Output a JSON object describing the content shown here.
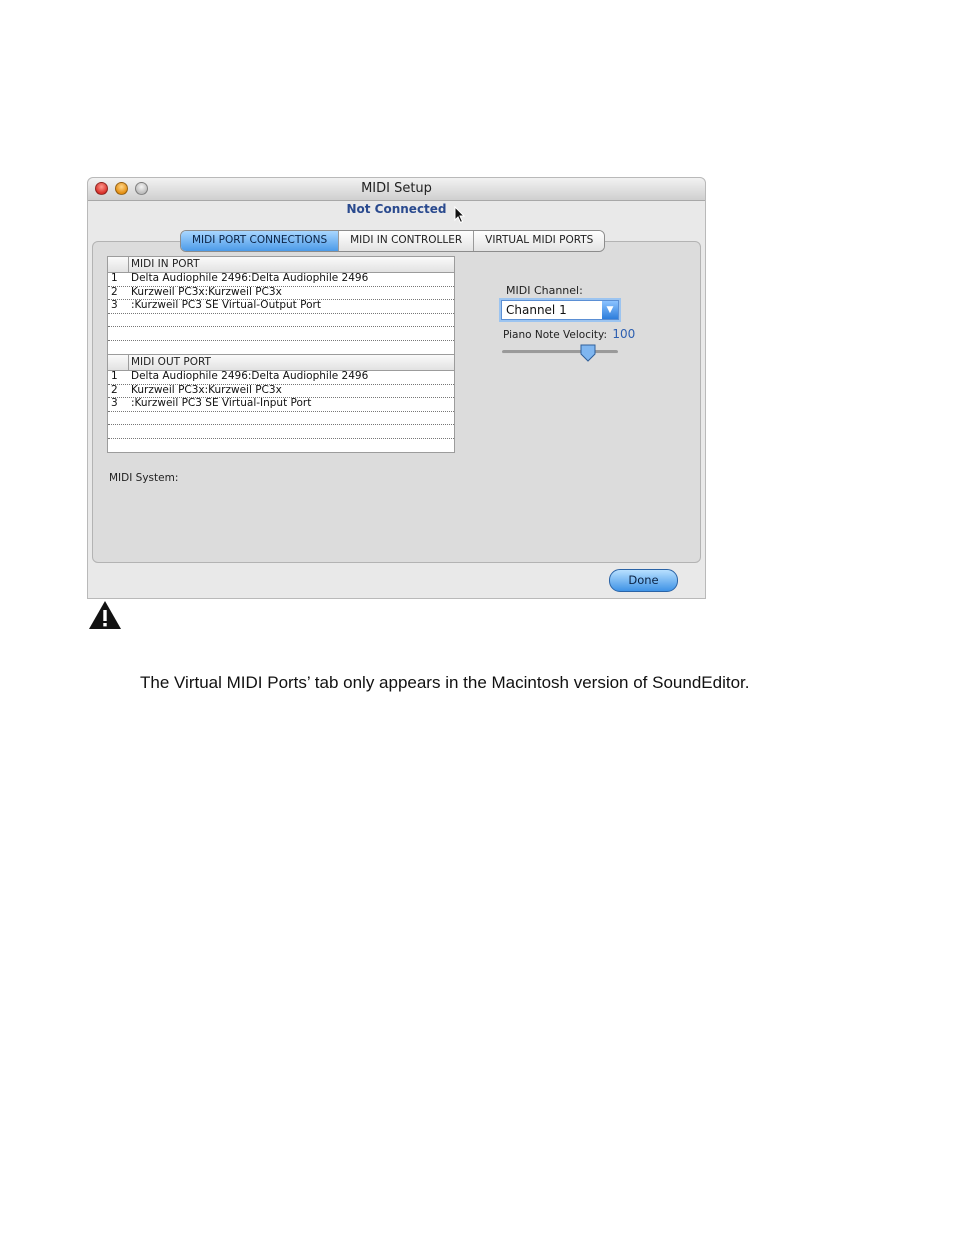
{
  "window": {
    "title": "MIDI Setup",
    "status": "Not Connected"
  },
  "tabs": [
    {
      "label": "MIDI PORT CONNECTIONS",
      "active": true
    },
    {
      "label": "MIDI IN CONTROLLER",
      "active": false
    },
    {
      "label": "VIRTUAL MIDI PORTS",
      "active": false
    }
  ],
  "midi_in": {
    "header": "MIDI IN PORT",
    "rows": [
      {
        "num": "1",
        "name": "Delta Audiophile 2496:Delta Audiophile 2496"
      },
      {
        "num": "2",
        "name": "Kurzweil PC3x:Kurzweil PC3x"
      },
      {
        "num": "3",
        "name": ":Kurzweil PC3 SE Virtual-Output Port"
      }
    ]
  },
  "midi_out": {
    "header": "MIDI OUT PORT",
    "rows": [
      {
        "num": "1",
        "name": "Delta Audiophile 2496:Delta Audiophile 2496"
      },
      {
        "num": "2",
        "name": "Kurzweil PC3x:Kurzweil PC3x"
      },
      {
        "num": "3",
        "name": ":Kurzweil PC3 SE Virtual-Input Port"
      }
    ]
  },
  "midi_system_label": "MIDI System:",
  "midi_channel": {
    "label": "MIDI Channel:",
    "value": "Channel 1"
  },
  "velocity": {
    "label": "Piano Note Velocity:",
    "value": "100",
    "slider_fraction": 0.74
  },
  "done_label": "Done",
  "note_text": "The Virtual MIDI Ports’ tab only appears in the Macintosh version of SoundEditor.",
  "icons": [
    "close-icon",
    "minimize-icon",
    "zoom-icon",
    "cursor-icon",
    "dropdown-arrow-icon",
    "slider-thumb-icon",
    "warning-icon"
  ],
  "colors": {
    "accent": "#4c9ae8",
    "status": "#2a4a8e"
  }
}
